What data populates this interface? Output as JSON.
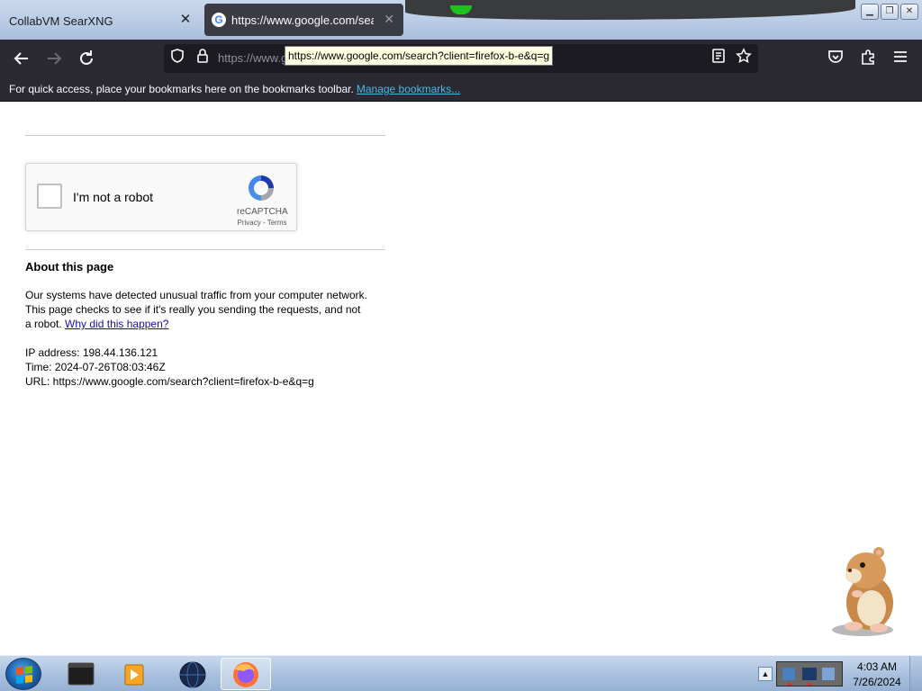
{
  "browser": {
    "tabs": [
      {
        "label": "CollabVM SearXNG",
        "active": false
      },
      {
        "label": "https://www.google.com/sear",
        "active": true,
        "favicon": "google-g-icon"
      }
    ],
    "url_display": "https://www.g                                                           oogle.com/search%3Fclient",
    "tooltip": "https://www.google.com/search?client=firefox-b-e&q=g",
    "bookmarks_bar": {
      "message": "For quick access, place your bookmarks here on the bookmarks toolbar.",
      "link_label": "Manage bookmarks..."
    }
  },
  "captcha": {
    "checkbox_label": "I'm not a robot",
    "brand": "reCAPTCHA",
    "legal": "Privacy - Terms"
  },
  "about": {
    "title": "About this page",
    "description": "Our systems have detected unusual traffic from your computer network. This page checks to see if it's really you sending the requests, and not a robot.",
    "why_link": "Why did this happen?",
    "ip_line": "IP address: 198.44.136.121",
    "time_line": "Time: 2024-07-26T08:03:46Z",
    "url_line": "URL: https://www.google.com/search?client=firefox-b-e&q=g"
  },
  "taskbar": {
    "clock_time": "4:03 AM",
    "clock_date": "7/26/2024",
    "apps": [
      "terminal-icon",
      "media-player-icon",
      "globe-icon",
      "firefox-icon"
    ]
  },
  "colors": {
    "tab_active_bg": "#3b3b44",
    "navbar_bg": "#2b2a33",
    "link_blue": "#1a0dab",
    "bookmark_link": "#49b8e7"
  }
}
